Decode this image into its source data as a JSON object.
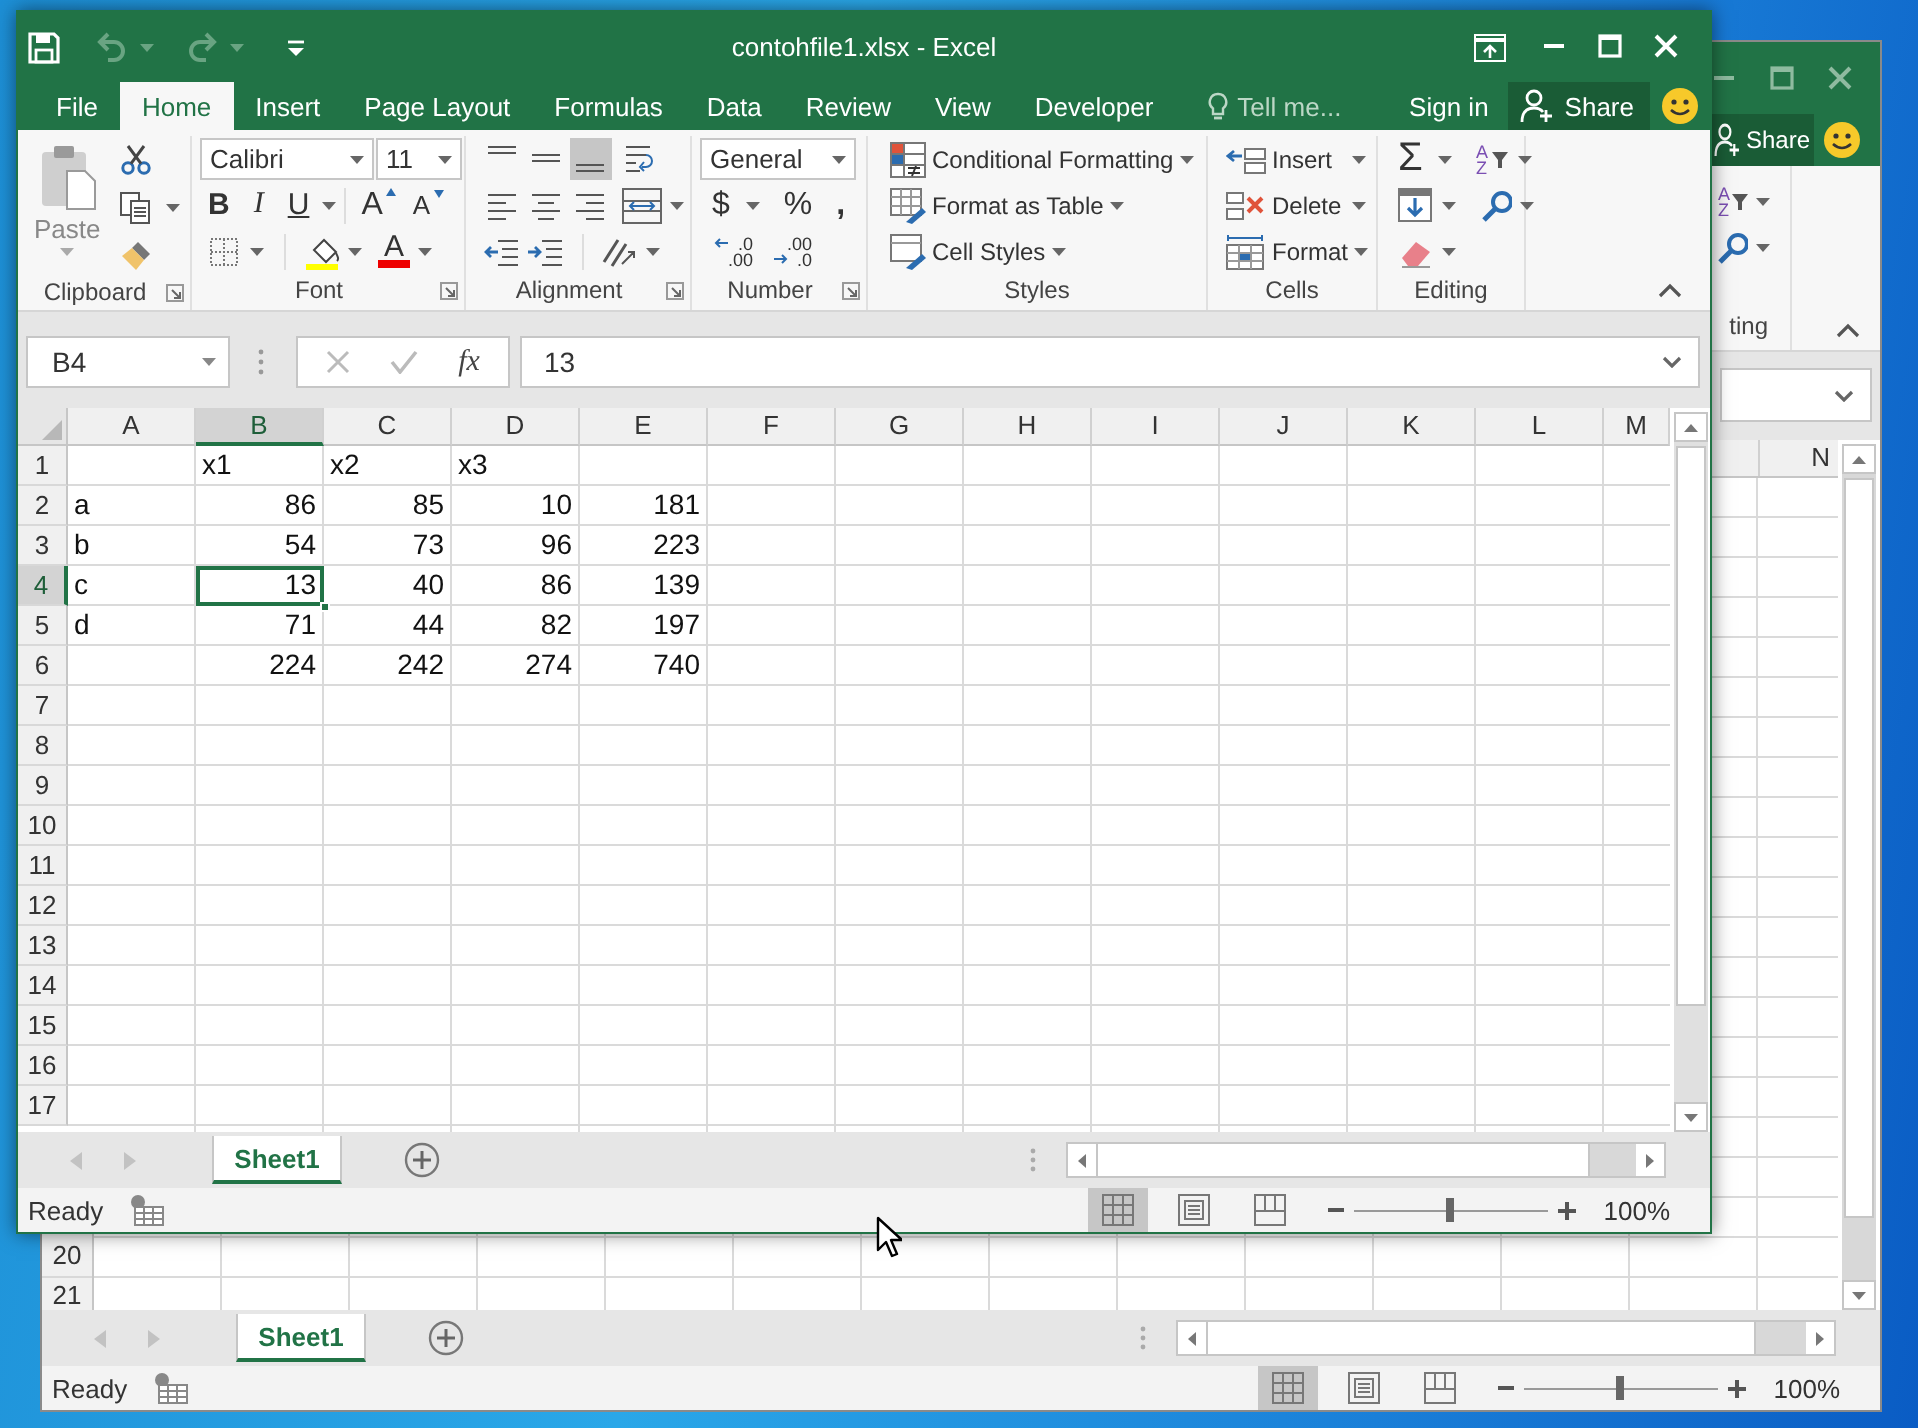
{
  "window": {
    "title": "contohfile1.xlsx - Excel"
  },
  "quick_access": [
    {
      "kind": "save",
      "disabled": false
    },
    {
      "kind": "undo",
      "disabled": true
    },
    {
      "kind": "redo",
      "disabled": true
    },
    {
      "kind": "customize",
      "disabled": false
    }
  ],
  "ribbon_tabs": [
    {
      "label": "File",
      "selected": false
    },
    {
      "label": "Home",
      "selected": true
    },
    {
      "label": "Insert",
      "selected": false
    },
    {
      "label": "Page Layout",
      "selected": false
    },
    {
      "label": "Formulas",
      "selected": false
    },
    {
      "label": "Data",
      "selected": false
    },
    {
      "label": "Review",
      "selected": false
    },
    {
      "label": "View",
      "selected": false
    },
    {
      "label": "Developer",
      "selected": false
    }
  ],
  "tell_me": "Tell me...",
  "sign_in": "Sign in",
  "share": "Share",
  "ribbon": {
    "groups": [
      {
        "kind": "clipboard",
        "label": "Clipboard",
        "launcher": true,
        "paste": {
          "label": "Paste",
          "disabled": true
        }
      },
      {
        "kind": "font",
        "label": "Font",
        "launcher": true,
        "font_name": "Calibri",
        "font_size": "11",
        "bold": "B",
        "italic": "I",
        "underline": "U",
        "grow": "A",
        "shrink": "A",
        "font_color": "A"
      },
      {
        "kind": "alignment",
        "label": "Alignment",
        "launcher": true,
        "vertical_align": [
          {
            "selected": false
          },
          {
            "selected": false
          },
          {
            "selected": true
          }
        ]
      },
      {
        "kind": "number",
        "label": "Number",
        "launcher": true,
        "format": "General",
        "currency": "$",
        "percent": "%",
        "comma": ",",
        "increase_decimal": [
          ".0",
          ".00"
        ],
        "decrease_decimal": [
          ".00",
          ".0"
        ]
      },
      {
        "kind": "styles",
        "label": "Styles",
        "launcher": false,
        "items": [
          "Conditional Formatting",
          "Format as Table",
          "Cell Styles"
        ]
      },
      {
        "kind": "cells",
        "label": "Cells",
        "launcher": false,
        "items": [
          "Insert",
          "Delete",
          "Format"
        ]
      },
      {
        "kind": "editing",
        "label": "Editing",
        "launcher": false,
        "autosum": "Σ",
        "sort": [
          "A",
          "Z"
        ]
      }
    ]
  },
  "formula_bar": {
    "name_box": "B4",
    "function_button": "fx",
    "formula": "13"
  },
  "sheet": {
    "columns": [
      {
        "label": "A",
        "selected": false
      },
      {
        "label": "B",
        "selected": true
      },
      {
        "label": "C",
        "selected": false
      },
      {
        "label": "D",
        "selected": false
      },
      {
        "label": "E",
        "selected": false
      },
      {
        "label": "F",
        "selected": false
      },
      {
        "label": "G",
        "selected": false
      },
      {
        "label": "H",
        "selected": false
      },
      {
        "label": "I",
        "selected": false
      },
      {
        "label": "J",
        "selected": false
      },
      {
        "label": "K",
        "selected": false
      },
      {
        "label": "L",
        "selected": false
      },
      {
        "label": "M",
        "selected": false
      }
    ],
    "rows": [
      {
        "number": "1",
        "selected": false,
        "headings": [
          "x1",
          "x2",
          "x3"
        ]
      },
      {
        "number": "2",
        "selected": false,
        "name": "a",
        "values": [
          "86",
          "85",
          "10",
          "181"
        ]
      },
      {
        "number": "3",
        "selected": false,
        "name": "b",
        "values": [
          "54",
          "73",
          "96",
          "223"
        ]
      },
      {
        "number": "4",
        "selected": true,
        "name": "c",
        "values": [
          "13",
          "40",
          "86",
          "139"
        ]
      },
      {
        "number": "5",
        "selected": false,
        "name": "d",
        "values": [
          "71",
          "44",
          "82",
          "197"
        ]
      },
      {
        "number": "6",
        "selected": false,
        "values": [
          "224",
          "242",
          "274",
          "740"
        ]
      },
      {
        "number": "7",
        "selected": false
      },
      {
        "number": "8",
        "selected": false
      },
      {
        "number": "9",
        "selected": false
      },
      {
        "number": "10",
        "selected": false
      },
      {
        "number": "11",
        "selected": false
      },
      {
        "number": "12",
        "selected": false
      },
      {
        "number": "13",
        "selected": false
      },
      {
        "number": "14",
        "selected": false
      },
      {
        "number": "15",
        "selected": false
      },
      {
        "number": "16",
        "selected": false
      },
      {
        "number": "17",
        "selected": false
      }
    ]
  },
  "sheet_tabs": [
    {
      "label": "Sheet1",
      "selected": true
    }
  ],
  "status_bar": {
    "status": "Ready",
    "views": [
      {
        "selected": true
      },
      {
        "selected": false
      },
      {
        "selected": false
      }
    ],
    "zoom": {
      "level": 0.5,
      "reading": "100%"
    }
  },
  "back_window": {
    "share": "Share",
    "sort": [
      "A",
      "Z"
    ],
    "group_label": "ting",
    "column_header": "N",
    "row_numbers": [
      "20",
      "21"
    ],
    "sheet_tabs": [
      {
        "label": "Sheet1",
        "selected": true
      }
    ],
    "status_bar": {
      "status": "Ready",
      "views": [
        {
          "selected": true
        },
        {
          "selected": false
        },
        {
          "selected": false
        }
      ],
      "zoom": {
        "level": 0.5,
        "reading": "100%"
      }
    }
  }
}
